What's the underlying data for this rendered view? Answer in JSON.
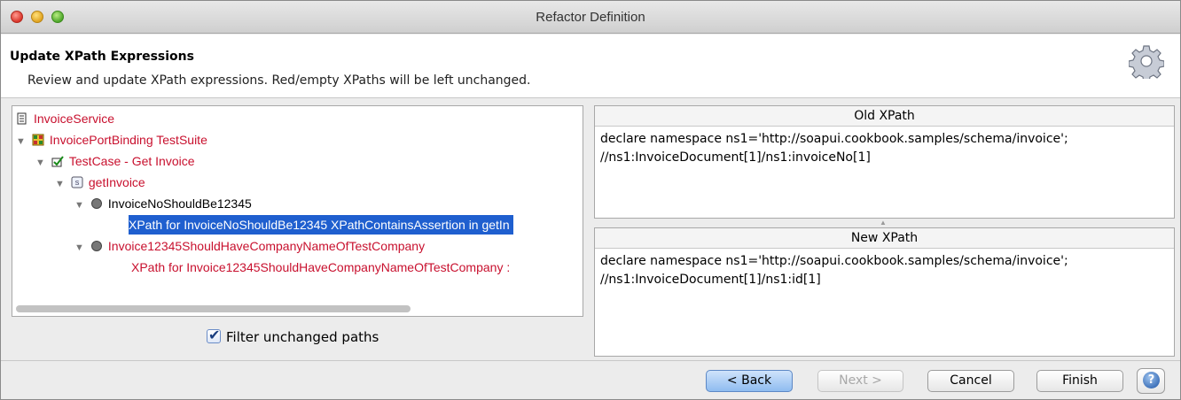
{
  "window": {
    "title": "Refactor Definition"
  },
  "header": {
    "title": "Update XPath Expressions",
    "description": "Review and update XPath expressions. Red/empty XPaths will be left unchanged."
  },
  "tree": {
    "service": "InvoiceService",
    "suite": "InvoicePortBinding TestSuite",
    "testcase": "TestCase - Get Invoice",
    "step": "getInvoice",
    "assertion1": "InvoiceNoShouldBe12345",
    "assertion1_xpath": "XPath for InvoiceNoShouldBe12345 XPathContainsAssertion in getIn",
    "assertion2": "Invoice12345ShouldHaveCompanyNameOfTestCompany",
    "assertion2_xpath": "XPath for Invoice12345ShouldHaveCompanyNameOfTestCompany :"
  },
  "filter": {
    "label": "Filter unchanged paths",
    "checked": true
  },
  "old_xpath": {
    "heading": "Old XPath",
    "line1": "declare namespace ns1='http://soapui.cookbook.samples/schema/invoice';",
    "line2": "//ns1:InvoiceDocument[1]/ns1:invoiceNo[1]"
  },
  "new_xpath": {
    "heading": "New XPath",
    "line1": "declare namespace ns1='http://soapui.cookbook.samples/schema/invoice';",
    "line2": "//ns1:InvoiceDocument[1]/ns1:id[1]"
  },
  "buttons": {
    "back": "< Back",
    "next": "Next >",
    "cancel": "Cancel",
    "finish": "Finish"
  },
  "colors": {
    "error_red": "#c8102e",
    "selection_blue": "#1f5fcf"
  }
}
